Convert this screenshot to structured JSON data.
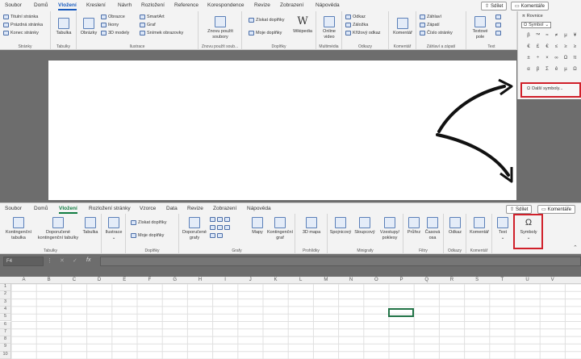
{
  "word": {
    "tabs": [
      "Soubor",
      "Domů",
      "Vložení",
      "Kreslení",
      "Návrh",
      "Rozložení",
      "Reference",
      "Korespondence",
      "Revize",
      "Zobrazení",
      "Nápověda"
    ],
    "share": "Sdílet",
    "comments": "Komentáře",
    "groups": {
      "pages": {
        "label": "Stránky",
        "items": [
          "Titulní stránka",
          "Prázdná stránka",
          "Konec stránky"
        ]
      },
      "tables": {
        "label": "Tabulky",
        "button": "Tabulka"
      },
      "illustrations": {
        "label": "Ilustrace",
        "images": "Obrázky",
        "items": [
          "Obrazce",
          "Ikony",
          "3D modely",
          "SmartArt",
          "Graf",
          "Snímek obrazovky"
        ]
      },
      "reuse": {
        "label": "Znovu použít soub...",
        "button": "Znovu použít soubory"
      },
      "addins": {
        "label": "Doplňky",
        "items": [
          "Získat doplňky",
          "Moje doplňky"
        ],
        "wiki": "Wikipedia"
      },
      "media": {
        "label": "Multimédia",
        "button": "Online video"
      },
      "links": {
        "label": "Odkazy",
        "items": [
          "Odkaz",
          "Záložka",
          "Křížový odkaz"
        ]
      },
      "comment": {
        "label": "Komentář",
        "button": "Komentář"
      },
      "headers": {
        "label": "Záhlaví a zápatí",
        "items": [
          "Záhlaví",
          "Zápatí",
          "Číslo stránky"
        ]
      },
      "text": {
        "label": "Text",
        "button": "Textové pole"
      }
    },
    "symbols": {
      "equation": "Rovnice",
      "symbol": "Symbol",
      "chars": [
        "β",
        "™",
        "≈",
        "≠",
        "μ",
        "¥",
        "€",
        "£",
        "€",
        "≤",
        "≥",
        "≥",
        "±",
        "÷",
        "×",
        "∞",
        "Ω",
        "π",
        "α",
        "β",
        "Σ",
        "ê",
        "µ",
        "Ω"
      ],
      "more": "Další symboly..."
    }
  },
  "excel": {
    "tabs": [
      "Soubor",
      "Domů",
      "Vložení",
      "Rozložení stránky",
      "Vzorce",
      "Data",
      "Revize",
      "Zobrazení",
      "Nápověda"
    ],
    "share": "Sdílet",
    "comments": "Komentáře",
    "groups": {
      "tables": {
        "label": "Tabulky",
        "buttons": [
          "Kontingenční tabulka",
          "Doporučené kontingenční tabulky",
          "Tabulka"
        ]
      },
      "illustrations": {
        "button": "Ilustrace"
      },
      "addins": {
        "label": "Doplňky",
        "items": [
          "Získat doplňky",
          "Moje doplňky"
        ]
      },
      "charts": {
        "label": "Grafy",
        "buttons": [
          "Doporučené grafy",
          "Mapy",
          "Kontingenční graf"
        ]
      },
      "tours": {
        "label": "Prohlídky",
        "button": "3D mapa"
      },
      "sparklines": {
        "label": "Minigrafy",
        "buttons": [
          "Spojnicový",
          "Sloupcový",
          "Vzestupy/ poklesy"
        ]
      },
      "filters": {
        "label": "Filtry",
        "buttons": [
          "Průřez",
          "Časová osa"
        ]
      },
      "links": {
        "label": "Odkazy",
        "button": "Odkaz"
      },
      "comments": {
        "label": "Komentář",
        "button": "Komentář"
      },
      "text": {
        "button": "Text"
      },
      "symbols": {
        "button": "Symboly"
      }
    },
    "namebox": "F4",
    "fx": "fx",
    "columns": [
      "A",
      "B",
      "C",
      "D",
      "E",
      "F",
      "G",
      "H",
      "I",
      "J",
      "K",
      "L",
      "M",
      "N",
      "O",
      "P",
      "Q",
      "R",
      "S",
      "T",
      "U",
      "V"
    ],
    "rows": [
      "1",
      "2",
      "3",
      "4",
      "5",
      "6",
      "7",
      "8",
      "9",
      "10"
    ]
  },
  "colors": {
    "word_accent": "#185abd",
    "excel_accent": "#107c41",
    "highlight": "#d0202a"
  }
}
